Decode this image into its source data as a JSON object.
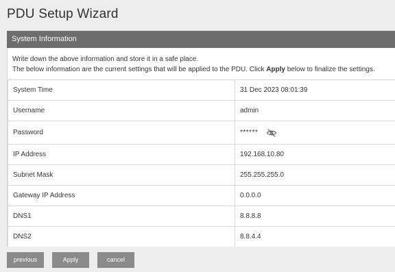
{
  "wizard": {
    "title": "PDU Setup Wizard"
  },
  "panel": {
    "header": "System Information",
    "intro_line1": "Write down the above information and store it in a safe place.",
    "intro_line2_prefix": "The below information are the current settings that will be applied to the PDU. Click ",
    "intro_line2_bold": "Apply",
    "intro_line2_suffix": " below to finalize the settings."
  },
  "rows": [
    {
      "label": "System Time",
      "value": "31 Dec 2023 08:01:39"
    },
    {
      "label": "Username",
      "value": "admin"
    },
    {
      "label": "Password",
      "value": "******"
    },
    {
      "label": "IP Address",
      "value": "192.168.10.80"
    },
    {
      "label": "Subnet Mask",
      "value": "255.255.255.0"
    },
    {
      "label": "Gateway IP Address",
      "value": "0.0.0.0"
    },
    {
      "label": "DNS1",
      "value": "8.8.8.8"
    },
    {
      "label": "DNS2",
      "value": "8.8.4.4"
    }
  ],
  "icons": {
    "password_toggle": "eye-slash-icon"
  },
  "buttons": {
    "previous": "previous",
    "apply": "Apply",
    "cancel": "cancel"
  },
  "colors": {
    "header_bg": "#6d6d6d",
    "button_bg": "#8a8a8a",
    "page_bg": "#ededed"
  }
}
